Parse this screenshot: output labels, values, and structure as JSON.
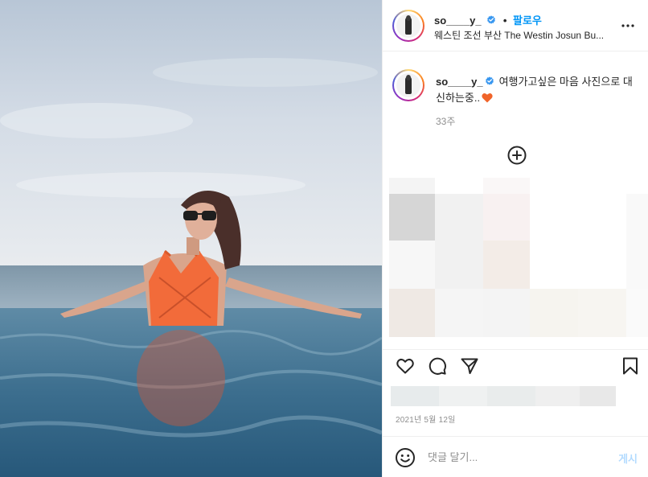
{
  "colors": {
    "accent": "#0095f6",
    "verified": "#3897f0",
    "text": "#262626",
    "muted": "#8e8e8e",
    "post_disabled": "#b3dbff",
    "heart_emoji": "#f0642a"
  },
  "header": {
    "username": "so____y_",
    "separator": "•",
    "follow_label": "팔로우",
    "location": "웨스틴 조선 부산 The Westin Josun Bu..."
  },
  "caption": {
    "username": "so____y_",
    "text": "여행가고싶은 마음 사진으로 대신하는중..",
    "time_ago": "33주"
  },
  "icons": {
    "more": "more-options-icon",
    "verified": "verified-badge-icon",
    "load_more": "plus-circle-icon",
    "like": "heart-outline-icon",
    "comment": "comment-bubble-icon",
    "share": "paper-plane-icon",
    "save": "bookmark-icon",
    "emoji": "smiley-icon"
  },
  "post_date": "2021년 5월 12일",
  "comment_box": {
    "placeholder": "댓글 달기...",
    "submit_label": "게시"
  }
}
